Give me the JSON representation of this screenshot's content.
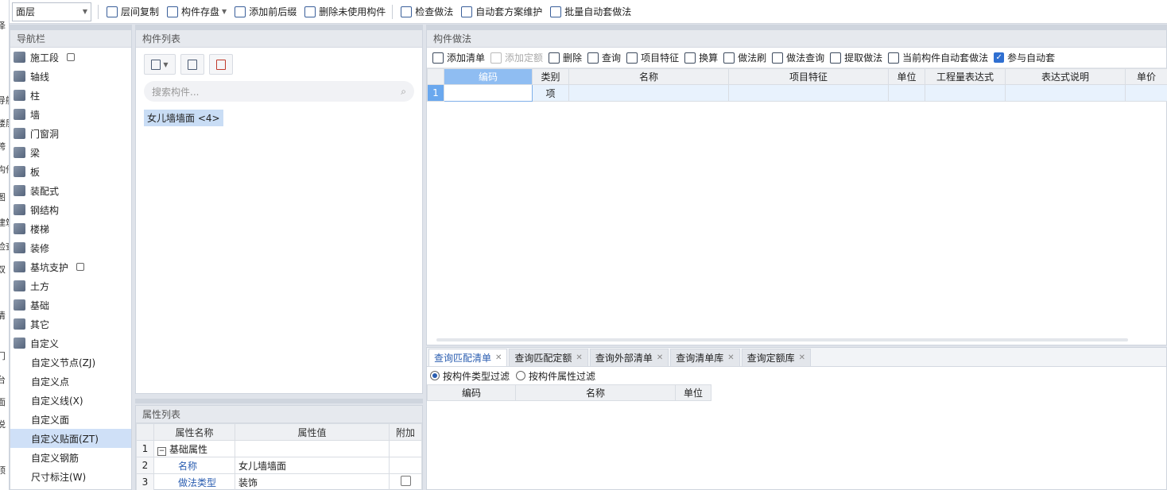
{
  "left_strip": [
    "泽",
    "导航",
    "楼层",
    "跨",
    "构件",
    "图",
    "建筑",
    "检查",
    "双",
    "清",
    "台",
    "门",
    "面",
    "说",
    "顶"
  ],
  "toolbar": {
    "floor": "面层",
    "buttons": [
      "层间复制",
      "构件存盘",
      "添加前后缀",
      "删除未使用构件",
      "检查做法",
      "自动套方案维护",
      "批量自动套做法"
    ]
  },
  "nav": {
    "title": "导航栏",
    "items": [
      {
        "label": "施工段",
        "lock": true
      },
      {
        "label": "轴线"
      },
      {
        "label": "柱"
      },
      {
        "label": "墙"
      },
      {
        "label": "门窗洞"
      },
      {
        "label": "梁"
      },
      {
        "label": "板"
      },
      {
        "label": "装配式"
      },
      {
        "label": "钢结构"
      },
      {
        "label": "楼梯"
      },
      {
        "label": "装修"
      },
      {
        "label": "基坑支护",
        "lock": true
      },
      {
        "label": "土方"
      },
      {
        "label": "基础"
      },
      {
        "label": "其它"
      },
      {
        "label": "自定义"
      }
    ],
    "sub_items": [
      "自定义节点(ZJ)",
      "自定义点",
      "自定义线(X)",
      "自定义面",
      "自定义贴面(ZT)",
      "自定义钢筋",
      "尺寸标注(W)"
    ],
    "selected": "自定义贴面(ZT)"
  },
  "component_list": {
    "title": "构件列表",
    "search_placeholder": "搜索构件...",
    "item": "女儿墙墙面 <4>"
  },
  "property_list": {
    "title": "属性列表",
    "headers": [
      "属性名称",
      "属性值",
      "附加"
    ],
    "rows": [
      {
        "num": "1",
        "name": "基础属性",
        "value": "",
        "group": true
      },
      {
        "num": "2",
        "name": "名称",
        "value": "女儿墙墙面"
      },
      {
        "num": "3",
        "name": "做法类型",
        "value": "装饰"
      }
    ]
  },
  "method": {
    "title": "构件做法",
    "tools": [
      {
        "label": "添加清单"
      },
      {
        "label": "添加定额",
        "disabled": true
      },
      {
        "label": "删除"
      },
      {
        "label": "查询"
      },
      {
        "label": "项目特征"
      },
      {
        "label": "换算"
      },
      {
        "label": "做法刷"
      },
      {
        "label": "做法查询"
      },
      {
        "label": "提取做法"
      },
      {
        "label": "当前构件自动套做法"
      }
    ],
    "auto_label": "参与自动套",
    "headers": [
      "编码",
      "类别",
      "名称",
      "项目特征",
      "单位",
      "工程量表达式",
      "表达式说明",
      "单价"
    ],
    "row": {
      "num": "1",
      "category": "项"
    }
  },
  "query": {
    "tabs": [
      "查询匹配清单",
      "查询匹配定额",
      "查询外部清单",
      "查询清单库",
      "查询定额库"
    ],
    "filters": [
      "按构件类型过滤",
      "按构件属性过滤"
    ],
    "headers": [
      "编码",
      "名称",
      "单位"
    ]
  }
}
